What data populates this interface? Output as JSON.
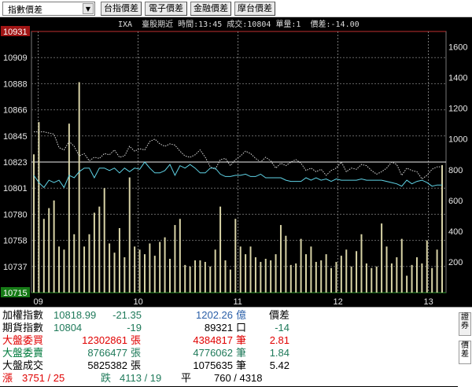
{
  "toolbar": {
    "selected_index": "指數價差",
    "buttons": [
      "台指價差",
      "電子價差",
      "金融價差",
      "摩台價差"
    ]
  },
  "chart_header": "IXA  臺股期近 時間:13:45 成交:10804 單量:1  價差:-14.00",
  "chart_data": {
    "type": "line",
    "price_axis": {
      "ticks": [
        "10931",
        "10909",
        "10888",
        "10866",
        "10845",
        "10823",
        "10801",
        "10780",
        "10758",
        "10737",
        "10715"
      ],
      "range": [
        10715,
        10931
      ],
      "highlight_top": "10931",
      "highlight_bottom": "10715"
    },
    "volume_axis": {
      "ticks": [
        "1600",
        "1400",
        "1200",
        "1000",
        "800",
        "600",
        "400",
        "200"
      ],
      "range": [
        0,
        1700
      ]
    },
    "x_ticks": [
      "09",
      "10",
      "11",
      "12",
      "13"
    ],
    "reference_price": 10823,
    "series": [
      {
        "color": "#d8d8d8",
        "style": "dotted",
        "values": [
          10848,
          10848,
          10848,
          10847,
          10846,
          10835,
          10833,
          10840,
          10836,
          10828,
          10830,
          10824,
          10827,
          10826,
          10830,
          10829,
          10833,
          10827,
          10828,
          10836,
          10832,
          10834,
          10833,
          10840,
          10842,
          10838,
          10836,
          10838,
          10837,
          10832,
          10828,
          10827,
          10829,
          10833,
          10827,
          10819,
          10817,
          10825,
          10826,
          10820,
          10825,
          10828,
          10832,
          10830,
          10826,
          10823,
          10827,
          10824,
          10818,
          10822,
          10820,
          10823,
          10825,
          10822,
          10816,
          10818,
          10815,
          10817,
          10812,
          10816,
          10818,
          10823,
          10815,
          10818,
          10817,
          10821,
          10820,
          10816,
          10813,
          10815,
          10818,
          10823,
          10821,
          10812,
          10818,
          10816,
          10815,
          10809,
          10812,
          10817,
          10819,
          10819
        ]
      },
      {
        "color": "#5fd3e6",
        "style": "solid",
        "values": [
          10812,
          10806,
          10802,
          10808,
          10806,
          10808,
          10802,
          10812,
          10810,
          10815,
          10818,
          10818,
          10810,
          10818,
          10818,
          10816,
          10818,
          10814,
          10818,
          10815,
          10818,
          10817,
          10823,
          10818,
          10814,
          10814,
          10816,
          10821,
          10812,
          10820,
          10818,
          10821,
          10818,
          10814,
          10814,
          10818,
          10818,
          10813,
          10811,
          10811,
          10812,
          10812,
          10813,
          10811,
          10811,
          10813,
          10810,
          10810,
          10810,
          10810,
          10808,
          10807,
          10807,
          10807,
          10810,
          10808,
          10810,
          10808,
          10809,
          10807,
          10809,
          10808,
          10808,
          10808,
          10808,
          10809,
          10808,
          10808,
          10808,
          10808,
          10807,
          10806,
          10805,
          10803,
          10808,
          10805,
          10807,
          10808,
          10806,
          10803,
          10804,
          10804
        ]
      }
    ],
    "volumes": [
      900,
      1110,
      480,
      550,
      600,
      300,
      280,
      1100,
      380,
      1370,
      300,
      380,
      520,
      560,
      680,
      320,
      260,
      420,
      230,
      750,
      300,
      280,
      250,
      320,
      240,
      330,
      360,
      220,
      440,
      480,
      180,
      170,
      210,
      210,
      200,
      170,
      280,
      560,
      210,
      150,
      480,
      300,
      250,
      300,
      230,
      200,
      220,
      210,
      250,
      440,
      370,
      180,
      190,
      350,
      250,
      300,
      200,
      210,
      250,
      160,
      200,
      240,
      280,
      170,
      270,
      380,
      190,
      160,
      170,
      450,
      300,
      190,
      230,
      350,
      110,
      180,
      230,
      190,
      340,
      160,
      280,
      830
    ]
  },
  "quotes": {
    "rows": [
      {
        "label": "加權指數",
        "c1": "10818.99",
        "c2": "-21.35",
        "c3": "1202.26",
        "unit": "億",
        "c4": "價差"
      },
      {
        "label": "期貨指數",
        "c1": "10804",
        "c2": "-19",
        "c3": "89321",
        "unit": "口",
        "c4": "-14"
      },
      {
        "label": "大盤委買",
        "c1": "",
        "c2": "12302861",
        "c2_unit": "張",
        "c3": "4384817",
        "unit": "筆",
        "c4": "2.81"
      },
      {
        "label": "大盤委賣",
        "c1": "",
        "c2": "8766477",
        "c2_unit": "張",
        "c3": "4776062",
        "unit": "筆",
        "c4": "1.84"
      },
      {
        "label": "大盤成交",
        "c1": "",
        "c2": "5825382",
        "c2_unit": "張",
        "c3": "1075635",
        "unit": "筆",
        "c4": "5.42"
      }
    ],
    "breadth": {
      "up_label": "漲",
      "up": "3751 / 25",
      "down_label": "跌",
      "down": "4113 / 19",
      "flat_label": "平",
      "flat": "760 / 4318"
    }
  },
  "side_tabs": [
    "證券",
    "價差"
  ]
}
